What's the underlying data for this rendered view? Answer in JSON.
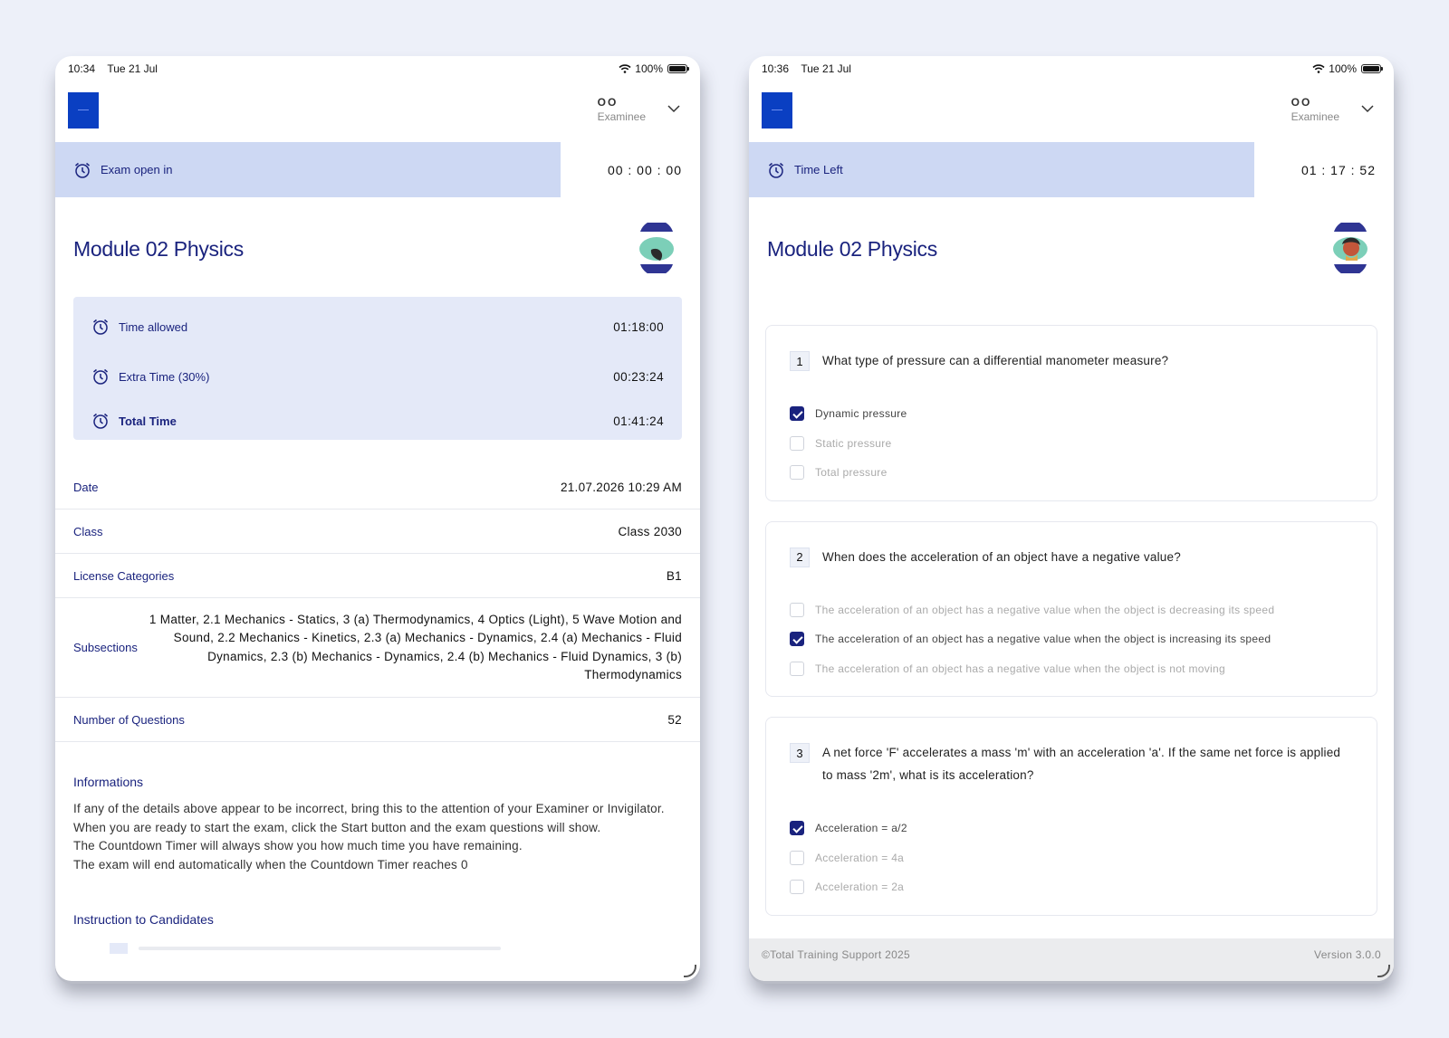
{
  "left": {
    "status": {
      "time": "10:34",
      "date": "Tue 21 Jul",
      "battery": "100%"
    },
    "user": {
      "initials": "OO",
      "role": "Examinee"
    },
    "timer": {
      "label": "Exam open in",
      "value": "00 : 00 : 00"
    },
    "title": "Module 02 Physics",
    "times": [
      {
        "label": "Time allowed",
        "value": "01:18:00"
      },
      {
        "label": "Extra Time (30%)",
        "value": "00:23:24"
      },
      {
        "label": "Total Time",
        "value": "01:41:24"
      }
    ],
    "details": [
      {
        "label": "Date",
        "value": "21.07.2026 10:29 AM"
      },
      {
        "label": "Class",
        "value": "Class 2030"
      },
      {
        "label": "License Categories",
        "value": "B1"
      },
      {
        "label": "Subsections",
        "value": "1 Matter, 2.1 Mechanics - Statics, 3 (a) Thermodynamics, 4 Optics (Light), 5 Wave Motion and Sound, 2.2 Mechanics - Kinetics, 2.3 (a) Mechanics - Dynamics, 2.4 (a) Mechanics - Fluid Dynamics, 2.3 (b) Mechanics - Dynamics, 2.4 (b) Mechanics - Fluid Dynamics, 3 (b) Thermodynamics"
      },
      {
        "label": "Number of Questions",
        "value": "52"
      }
    ],
    "informations": {
      "heading": "Informations",
      "lines": [
        "If any of the details above appear to be incorrect, bring this to the attention of your Examiner or Invigilator.",
        "When you are ready to start the exam, click the Start button and the exam questions will show.",
        "The Countdown Timer will always show you how much time you have remaining.",
        "The exam will end automatically when the Countdown Timer reaches 0"
      ]
    },
    "instructions_heading": "Instruction to Candidates"
  },
  "right": {
    "status": {
      "time": "10:36",
      "date": "Tue 21 Jul",
      "battery": "100%"
    },
    "user": {
      "initials": "OO",
      "role": "Examinee"
    },
    "timer": {
      "label": "Time Left",
      "value": "01 : 17 : 52"
    },
    "title": "Module 02 Physics",
    "questions": [
      {
        "number": "1",
        "text": "What type of pressure can a differential manometer measure?",
        "options": [
          {
            "text": "Dynamic pressure",
            "checked": true
          },
          {
            "text": "Static pressure",
            "checked": false
          },
          {
            "text": "Total pressure",
            "checked": false
          }
        ]
      },
      {
        "number": "2",
        "text": "When does the acceleration of an object have a negative value?",
        "options": [
          {
            "text": "The acceleration of an object has a negative value when the object is decreasing its speed",
            "checked": false
          },
          {
            "text": "The acceleration of an object has a negative value when the object is increasing its speed",
            "checked": true
          },
          {
            "text": "The acceleration of an object has a negative value when the object is not moving",
            "checked": false
          }
        ]
      },
      {
        "number": "3",
        "text": "A net force 'F' accelerates a mass 'm' with an acceleration 'a'.  If the same net force is applied to mass '2m', what is its acceleration?",
        "options": [
          {
            "text": "Acceleration = a/2",
            "checked": true
          },
          {
            "text": "Acceleration = 4a",
            "checked": false
          },
          {
            "text": "Acceleration = 2a",
            "checked": false
          }
        ]
      }
    ],
    "footer": {
      "copyright": "©Total Training Support 2025",
      "version": "Version 3.0.0"
    }
  },
  "colors": {
    "accent": "#1a237e",
    "timerbar": "#cdd8f3",
    "infobox": "#e4e9f8",
    "logo": "#0a3fc2"
  }
}
